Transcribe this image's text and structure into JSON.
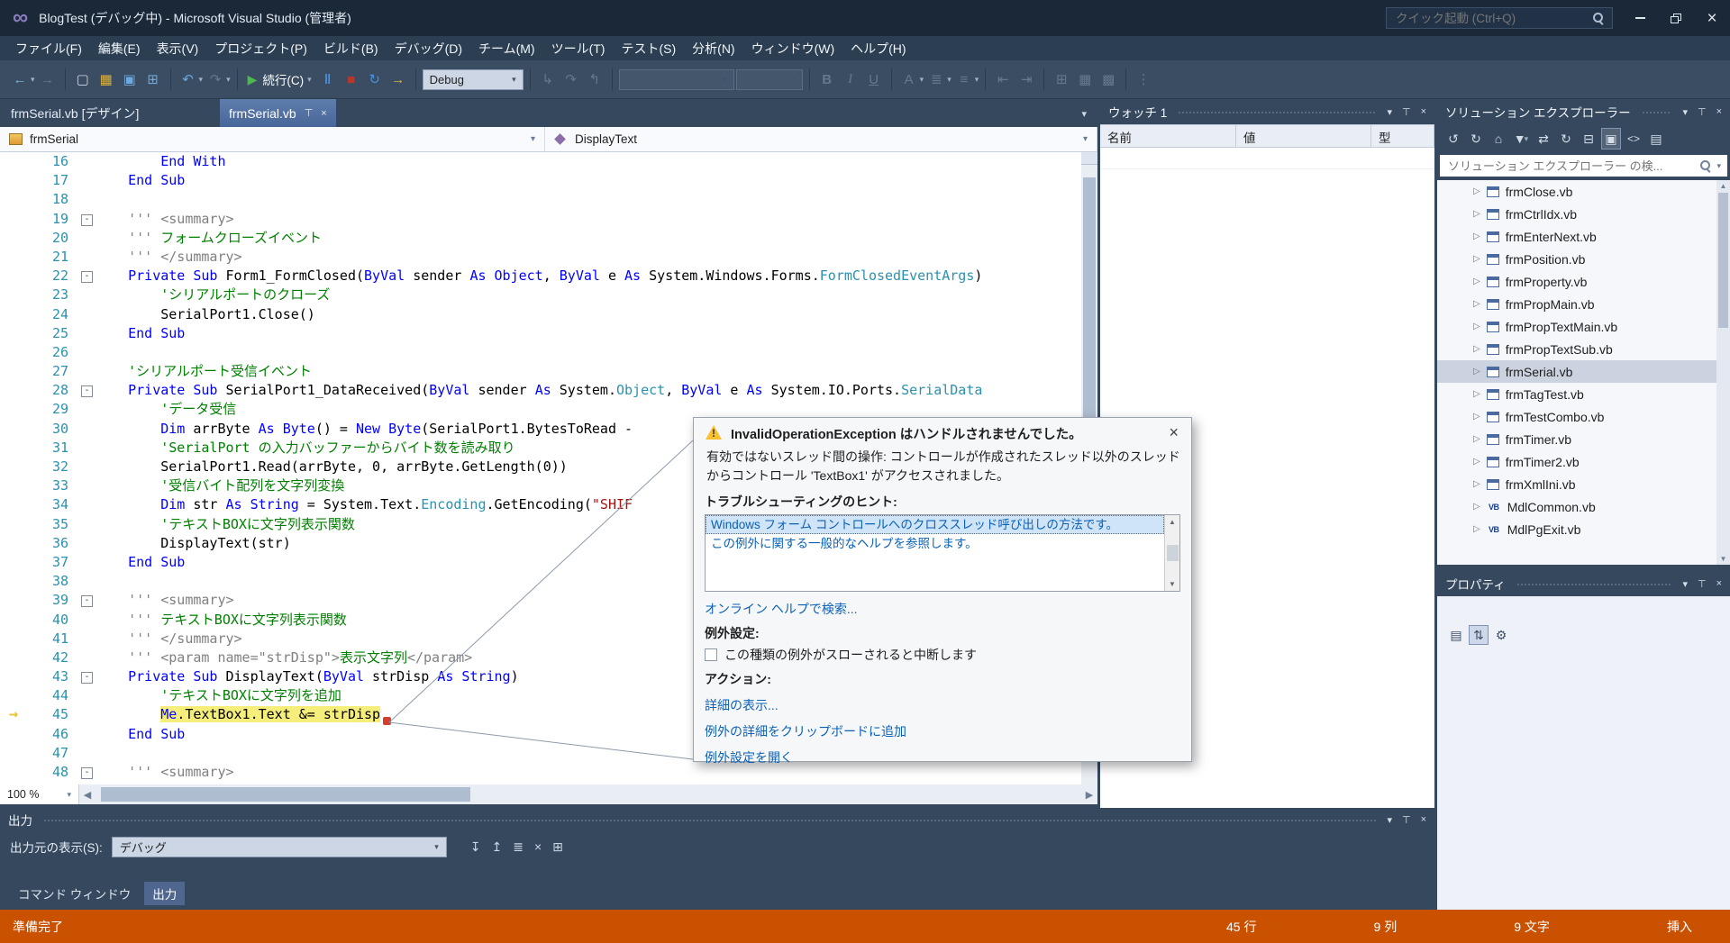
{
  "colors": {
    "status_bar": "#CA5100",
    "exec_highlight": "#F6EE7B",
    "keyword": "#0000FF",
    "comment": "#008000",
    "type_name": "#2B91AF",
    "string": "#A31515",
    "link": "#0B61B8",
    "active_tab": "#5D7DAB"
  },
  "title_bar": {
    "title": "BlogTest (デバッグ中) - Microsoft Visual Studio (管理者)",
    "quick_launch_placeholder": "クイック起動 (Ctrl+Q)"
  },
  "menu_bar": {
    "items": [
      "ファイル(F)",
      "編集(E)",
      "表示(V)",
      "プロジェクト(P)",
      "ビルド(B)",
      "デバッグ(D)",
      "チーム(M)",
      "ツール(T)",
      "テスト(S)",
      "分析(N)",
      "ウィンドウ(W)",
      "ヘルプ(H)"
    ]
  },
  "toolbar": {
    "continue_label": "続行(C)",
    "debug_config": "Debug"
  },
  "editor": {
    "design_tab": "frmSerial.vb [デザイン]",
    "active_tab": "frmSerial.vb",
    "nav": {
      "class_name": "frmSerial",
      "member_name": "DisplayText"
    },
    "zoom": "100 %",
    "lines": [
      {
        "num": 16,
        "segments": [
          [
            "        ",
            "p"
          ],
          [
            "End With",
            "k"
          ]
        ]
      },
      {
        "num": 17,
        "segments": [
          [
            "    ",
            "p"
          ],
          [
            "End Sub",
            "k"
          ]
        ]
      },
      {
        "num": 18,
        "segments": []
      },
      {
        "num": 19,
        "fold": true,
        "segments": [
          [
            "    ",
            "p"
          ],
          [
            "''' <summary>",
            "g"
          ]
        ]
      },
      {
        "num": 20,
        "segments": [
          [
            "    ",
            "p"
          ],
          [
            "''' ",
            "g"
          ],
          [
            "フォームクローズイベント",
            "c"
          ]
        ]
      },
      {
        "num": 21,
        "segments": [
          [
            "    ",
            "p"
          ],
          [
            "''' </summary>",
            "g"
          ]
        ]
      },
      {
        "num": 22,
        "fold": true,
        "segments": [
          [
            "    ",
            "p"
          ],
          [
            "Private Sub",
            "k"
          ],
          [
            " Form1_FormClosed(",
            "p"
          ],
          [
            "ByVal",
            "k"
          ],
          [
            " sender ",
            "p"
          ],
          [
            "As",
            "k"
          ],
          [
            " ",
            "p"
          ],
          [
            "Object",
            "k"
          ],
          [
            ", ",
            "p"
          ],
          [
            "ByVal",
            "k"
          ],
          [
            " e ",
            "p"
          ],
          [
            "As",
            "k"
          ],
          [
            " System.Windows.Forms.",
            "p"
          ],
          [
            "FormClosedEventArgs",
            "t"
          ],
          [
            ")",
            "p"
          ]
        ]
      },
      {
        "num": 23,
        "segments": [
          [
            "        ",
            "p"
          ],
          [
            "'シリアルポートのクローズ",
            "c"
          ]
        ]
      },
      {
        "num": 24,
        "segments": [
          [
            "        ",
            "p"
          ],
          [
            "SerialPort1.Close()",
            "p"
          ]
        ]
      },
      {
        "num": 25,
        "segments": [
          [
            "    ",
            "p"
          ],
          [
            "End Sub",
            "k"
          ]
        ]
      },
      {
        "num": 26,
        "segments": []
      },
      {
        "num": 27,
        "segments": [
          [
            "    ",
            "p"
          ],
          [
            "'シリアルポート受信イベント",
            "c"
          ]
        ]
      },
      {
        "num": 28,
        "fold": true,
        "segments": [
          [
            "    ",
            "p"
          ],
          [
            "Private Sub",
            "k"
          ],
          [
            " SerialPort1_DataReceived(",
            "p"
          ],
          [
            "ByVal",
            "k"
          ],
          [
            " sender ",
            "p"
          ],
          [
            "As",
            "k"
          ],
          [
            " System.",
            "p"
          ],
          [
            "Object",
            "t"
          ],
          [
            ", ",
            "p"
          ],
          [
            "ByVal",
            "k"
          ],
          [
            " e ",
            "p"
          ],
          [
            "As",
            "k"
          ],
          [
            " System.IO.Ports.",
            "p"
          ],
          [
            "SerialData",
            "t"
          ]
        ]
      },
      {
        "num": 29,
        "segments": [
          [
            "        ",
            "p"
          ],
          [
            "'データ受信",
            "c"
          ]
        ]
      },
      {
        "num": 30,
        "segments": [
          [
            "        ",
            "p"
          ],
          [
            "Dim",
            "k"
          ],
          [
            " arrByte ",
            "p"
          ],
          [
            "As",
            "k"
          ],
          [
            " ",
            "p"
          ],
          [
            "Byte",
            "k"
          ],
          [
            "() = ",
            "p"
          ],
          [
            "New",
            "k"
          ],
          [
            " ",
            "p"
          ],
          [
            "Byte",
            "k"
          ],
          [
            "(SerialPort1.BytesToRead - ",
            "p"
          ]
        ]
      },
      {
        "num": 31,
        "segments": [
          [
            "        ",
            "p"
          ],
          [
            "'SerialPort の入力バッファーからバイト数を読み取り",
            "c"
          ]
        ]
      },
      {
        "num": 32,
        "segments": [
          [
            "        ",
            "p"
          ],
          [
            "SerialPort1.Read(arrByte, 0, arrByte.GetLength(0))",
            "p"
          ]
        ]
      },
      {
        "num": 33,
        "segments": [
          [
            "        ",
            "p"
          ],
          [
            "'受信バイト配列を文字列変換",
            "c"
          ]
        ]
      },
      {
        "num": 34,
        "segments": [
          [
            "        ",
            "p"
          ],
          [
            "Dim",
            "k"
          ],
          [
            " str ",
            "p"
          ],
          [
            "As",
            "k"
          ],
          [
            " ",
            "p"
          ],
          [
            "String",
            "k"
          ],
          [
            " = System.Text.",
            "p"
          ],
          [
            "Encoding",
            "t"
          ],
          [
            ".GetEncoding(",
            "p"
          ],
          [
            "\"SHIF",
            "s"
          ]
        ]
      },
      {
        "num": 35,
        "segments": [
          [
            "        ",
            "p"
          ],
          [
            "'テキストBOXに文字列表示関数",
            "c"
          ]
        ]
      },
      {
        "num": 36,
        "segments": [
          [
            "        ",
            "p"
          ],
          [
            "DisplayText(str)",
            "p"
          ]
        ]
      },
      {
        "num": 37,
        "segments": [
          [
            "    ",
            "p"
          ],
          [
            "End Sub",
            "k"
          ]
        ]
      },
      {
        "num": 38,
        "segments": []
      },
      {
        "num": 39,
        "fold": true,
        "segments": [
          [
            "    ",
            "p"
          ],
          [
            "''' <summary>",
            "g"
          ]
        ]
      },
      {
        "num": 40,
        "segments": [
          [
            "    ",
            "p"
          ],
          [
            "''' ",
            "g"
          ],
          [
            "テキストBOXに文字列表示関数",
            "c"
          ]
        ]
      },
      {
        "num": 41,
        "segments": [
          [
            "    ",
            "p"
          ],
          [
            "''' </summary>",
            "g"
          ]
        ]
      },
      {
        "num": 42,
        "segments": [
          [
            "    ",
            "p"
          ],
          [
            "''' <param name=\"strDisp\">",
            "g"
          ],
          [
            "表示文字列",
            "c"
          ],
          [
            "</param>",
            "g"
          ]
        ]
      },
      {
        "num": 43,
        "fold": true,
        "segments": [
          [
            "    ",
            "p"
          ],
          [
            "Private Sub",
            "k"
          ],
          [
            " DisplayText(",
            "p"
          ],
          [
            "ByVal",
            "k"
          ],
          [
            " strDisp ",
            "p"
          ],
          [
            "As",
            "k"
          ],
          [
            " ",
            "p"
          ],
          [
            "String",
            "k"
          ],
          [
            ")",
            "p"
          ]
        ]
      },
      {
        "num": 44,
        "segments": [
          [
            "        ",
            "p"
          ],
          [
            "'テキストBOXに文字列を追加",
            "c"
          ]
        ]
      },
      {
        "num": 45,
        "arrow": true,
        "err": true,
        "segments": [
          [
            "        ",
            "p"
          ],
          [
            "Me",
            "k",
            "hl"
          ],
          [
            ".TextBox1.Text &= strDisp",
            "p",
            "hl"
          ]
        ]
      },
      {
        "num": 46,
        "segments": [
          [
            "    ",
            "p"
          ],
          [
            "End Sub",
            "k"
          ]
        ]
      },
      {
        "num": 47,
        "segments": []
      },
      {
        "num": 48,
        "fold": true,
        "segments": [
          [
            "    ",
            "p"
          ],
          [
            "''' <summary>",
            "g"
          ]
        ]
      }
    ]
  },
  "exception_dialog": {
    "title": "InvalidOperationException はハンドルされませんでした。",
    "body": "有効ではないスレッド間の操作: コントロールが作成されたスレッド以外のスレッドからコントロール 'TextBox1' がアクセスされました。",
    "hints_label": "トラブルシューティングのヒント:",
    "hints": [
      {
        "text": "Windows フォーム コントロールへのクロススレッド呼び出しの方法です。",
        "selected": true
      },
      {
        "text": "この例外に関する一般的なヘルプを参照します。",
        "selected": false
      }
    ],
    "online_help_link": "オンライン ヘルプで検索...",
    "settings_label": "例外設定:",
    "checkbox_label": "この種類の例外がスローされると中断します",
    "actions_label": "アクション:",
    "action_links": [
      "詳細の表示...",
      "例外の詳細をクリップボードに追加",
      "例外設定を開く"
    ]
  },
  "watch": {
    "title": "ウォッチ 1",
    "columns": [
      "名前",
      "値",
      "型"
    ]
  },
  "solution_explorer": {
    "title": "ソリューション エクスプローラー",
    "search_placeholder": "ソリューション エクスプローラー の検...",
    "items": [
      {
        "label": "frmClose.vb",
        "icon": "form"
      },
      {
        "label": "frmCtrlIdx.vb",
        "icon": "form"
      },
      {
        "label": "frmEnterNext.vb",
        "icon": "form"
      },
      {
        "label": "frmPosition.vb",
        "icon": "form"
      },
      {
        "label": "frmProperty.vb",
        "icon": "form"
      },
      {
        "label": "frmPropMain.vb",
        "icon": "form"
      },
      {
        "label": "frmPropTextMain.vb",
        "icon": "form"
      },
      {
        "label": "frmPropTextSub.vb",
        "icon": "form"
      },
      {
        "label": "frmSerial.vb",
        "icon": "form",
        "selected": true
      },
      {
        "label": "frmTagTest.vb",
        "icon": "form"
      },
      {
        "label": "frmTestCombo.vb",
        "icon": "form"
      },
      {
        "label": "frmTimer.vb",
        "icon": "form"
      },
      {
        "label": "frmTimer2.vb",
        "icon": "form"
      },
      {
        "label": "frmXmlIni.vb",
        "icon": "form"
      },
      {
        "label": "MdlCommon.vb",
        "icon": "vb"
      },
      {
        "label": "MdlPgExit.vb",
        "icon": "vb"
      }
    ]
  },
  "properties": {
    "title": "プロパティ"
  },
  "output": {
    "title": "出力",
    "source_label": "出力元の表示(S):",
    "source_value": "デバッグ",
    "tabs": [
      {
        "label": "コマンド ウィンドウ",
        "active": false
      },
      {
        "label": "出力",
        "active": true
      }
    ]
  },
  "status_bar": {
    "ready": "準備完了",
    "items": [
      "45 行",
      "9 列",
      "9 文字",
      "挿入"
    ]
  }
}
